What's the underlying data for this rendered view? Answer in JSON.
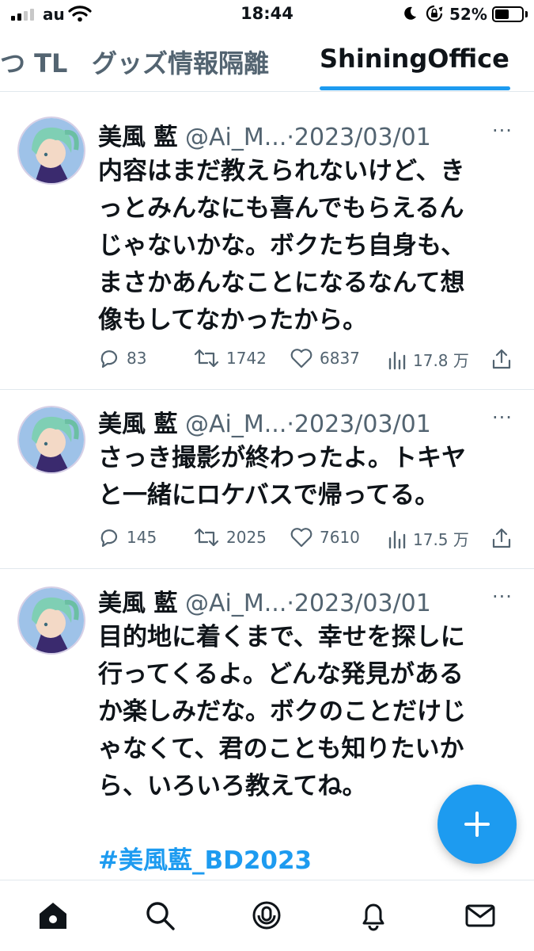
{
  "status_bar": {
    "carrier": "au",
    "time": "18:44",
    "battery_percent": "52%",
    "battery_level": 0.52,
    "icons": [
      "signal-icon",
      "wifi-icon",
      "moon-icon",
      "rotation-lock-icon",
      "battery-icon"
    ]
  },
  "tabs": [
    {
      "label": "つ TL",
      "active": false
    },
    {
      "label": "グッズ情報隔離",
      "active": false
    },
    {
      "label": "ShiningOffice",
      "active": true
    }
  ],
  "tweets": [
    {
      "author": "美風 藍",
      "handle": "@Ai_M...",
      "separator": "·",
      "date": "2023/03/01",
      "text_lines": [
        "内容はまだ教えられないけど、き",
        "っとみんなにも喜んでもらえるん",
        "じゃないかな。ボクたち自身も、",
        "まさかあんなことになるなんて想",
        "像もしてなかったから。"
      ],
      "replies": "83",
      "retweets": "1742",
      "likes": "6837",
      "views": "17.8 万"
    },
    {
      "author": "美風 藍",
      "handle": "@Ai_M...",
      "separator": "·",
      "date": "2023/03/01",
      "text_lines": [
        "さっき撮影が終わったよ。トキヤ",
        "と一緒にロケバスで帰ってる。"
      ],
      "replies": "145",
      "retweets": "2025",
      "likes": "7610",
      "views": "17.5 万"
    },
    {
      "author": "美風 藍",
      "handle": "@Ai_M...",
      "separator": "·",
      "date": "2023/03/01",
      "text_lines": [
        "目的地に着くまで、幸せを探しに",
        "行ってくるよ。どんな発見がある",
        "か楽しみだな。ボクのことだけじ",
        "ゃなくて、君のことも知りたいか",
        "ら、いろいろ教えてね。"
      ],
      "hashtag": "#美風藍_BD2023"
    }
  ],
  "more_glyph": "···",
  "fab": {
    "icon": "plus-icon"
  },
  "bottom_nav": [
    "home-icon",
    "search-icon",
    "spaces-icon",
    "notifications-icon",
    "messages-icon"
  ],
  "colors": {
    "accent": "#1d9bf0",
    "text": "#0f1419",
    "secondary": "#536471",
    "divider": "#e1e8ed"
  }
}
